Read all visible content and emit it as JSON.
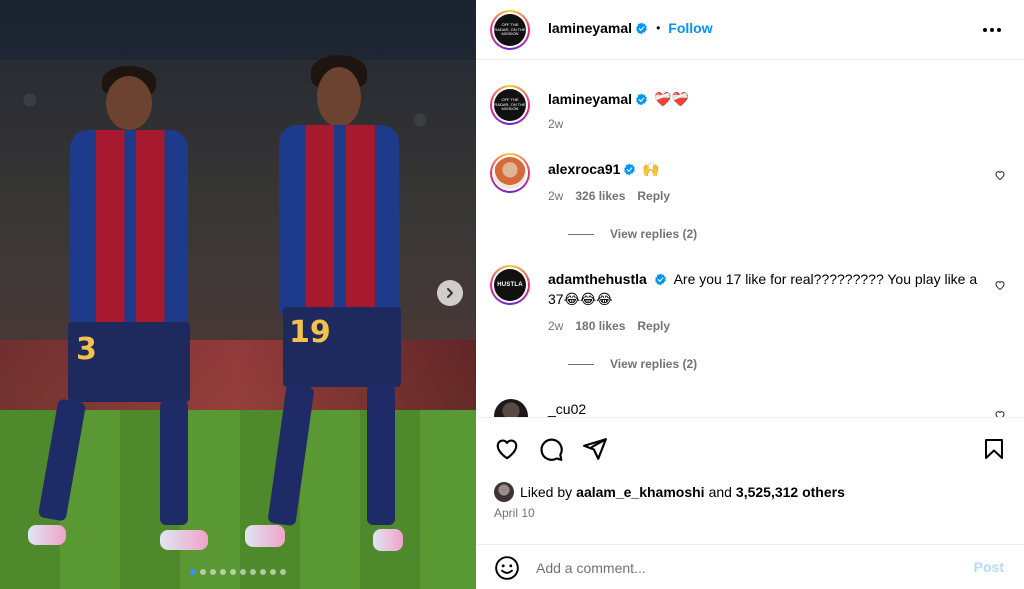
{
  "post": {
    "author": "lamineyamal",
    "follow_label": "Follow",
    "separator": "•",
    "avatar_text": "OFF THE RADAR, ON THE MISSION",
    "more_icon": "more-horizontal-icon"
  },
  "photo": {
    "player_numbers": [
      "3",
      "19"
    ],
    "carousel": {
      "total": 10,
      "active_index": 0
    },
    "next_icon": "chevron-right-icon"
  },
  "caption": {
    "username": "lamineyamal",
    "text": "❤️‍🩹❤️‍🩹",
    "time": "2w"
  },
  "comments": [
    {
      "username": "alexroca91",
      "text": "🙌",
      "time": "2w",
      "likes": "326 likes",
      "reply": "Reply",
      "view_replies": "View replies (2)",
      "verified": true
    },
    {
      "username": "adamthehustla",
      "avatar_text": "HUSTLA",
      "text": "Are you 17 like for real????????? You play like a 37😂😂😂",
      "time": "2w",
      "likes": "180 likes",
      "reply": "Reply",
      "view_replies": "View replies (2)",
      "verified": true
    },
    {
      "username": "_cu02",
      "verified": false
    }
  ],
  "actions": {
    "liked_by_prefix": "Liked by",
    "liked_by_user": "aalam_e_khamoshi",
    "liked_by_and": "and",
    "liked_by_count": "3,525,312 others",
    "date": "April 10"
  },
  "comment_box": {
    "placeholder": "Add a comment...",
    "post_label": "Post",
    "emoji_icon": "smiley-icon"
  },
  "colors": {
    "accent": "#0095f6",
    "muted": "#737373",
    "post_disabled": "#b3dbff",
    "verified": "#0095f6"
  }
}
